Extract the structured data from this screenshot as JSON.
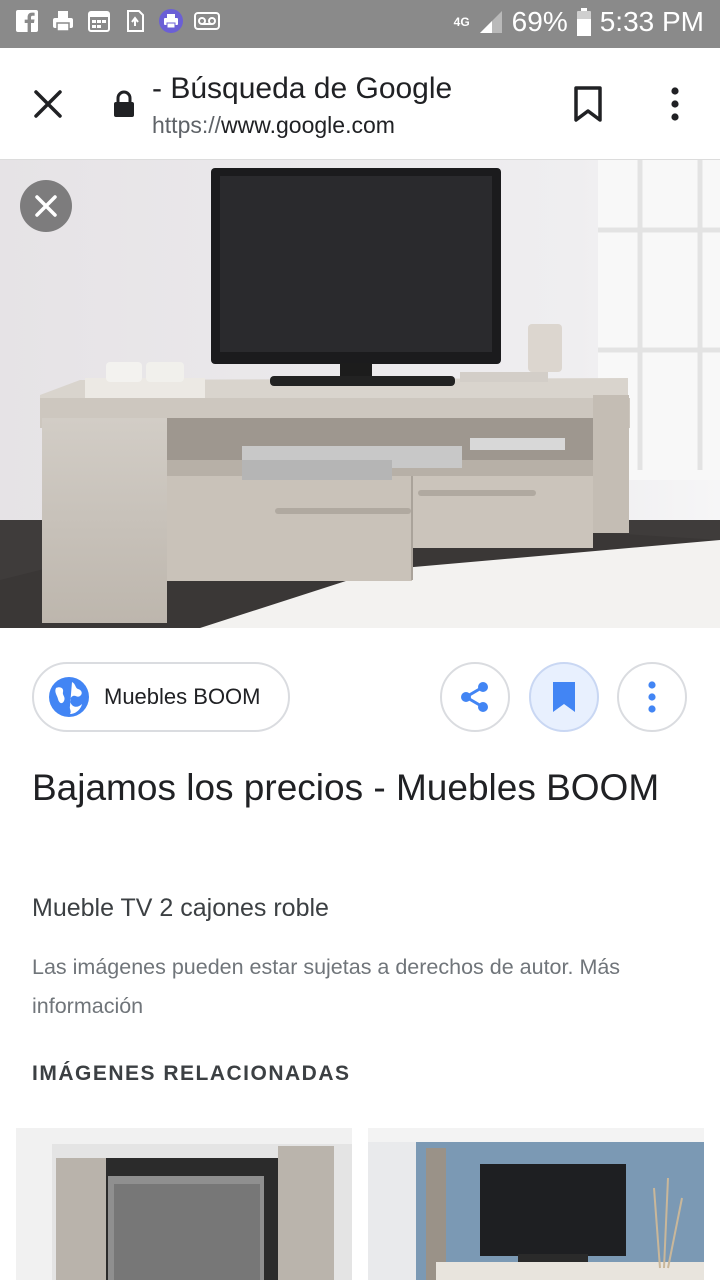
{
  "status_bar": {
    "network": "4G",
    "battery": "69%",
    "time": "5:33 PM",
    "icons": [
      "facebook-icon",
      "printer-icon",
      "calendar-icon",
      "recycle-icon",
      "printer-badge-icon",
      "voicemail-icon"
    ]
  },
  "browser": {
    "title": "- Búsqueda de Google",
    "url_scheme": "https://",
    "url_host": "www.google.com"
  },
  "source": {
    "label": "Muebles BOOM"
  },
  "result": {
    "title": "Bajamos los precios - Muebles BOOM",
    "subtitle": "Mueble TV 2 cajones roble",
    "copyright_text": "Las imágenes pueden estar sujetas a derechos de autor.",
    "more_info": "Más información"
  },
  "related": {
    "heading": "IMÁGENES RELACIONADAS"
  },
  "colors": {
    "accent": "#4285f4",
    "status_bar": "#8a8a8a",
    "save_active_bg": "#e8f0fe"
  }
}
